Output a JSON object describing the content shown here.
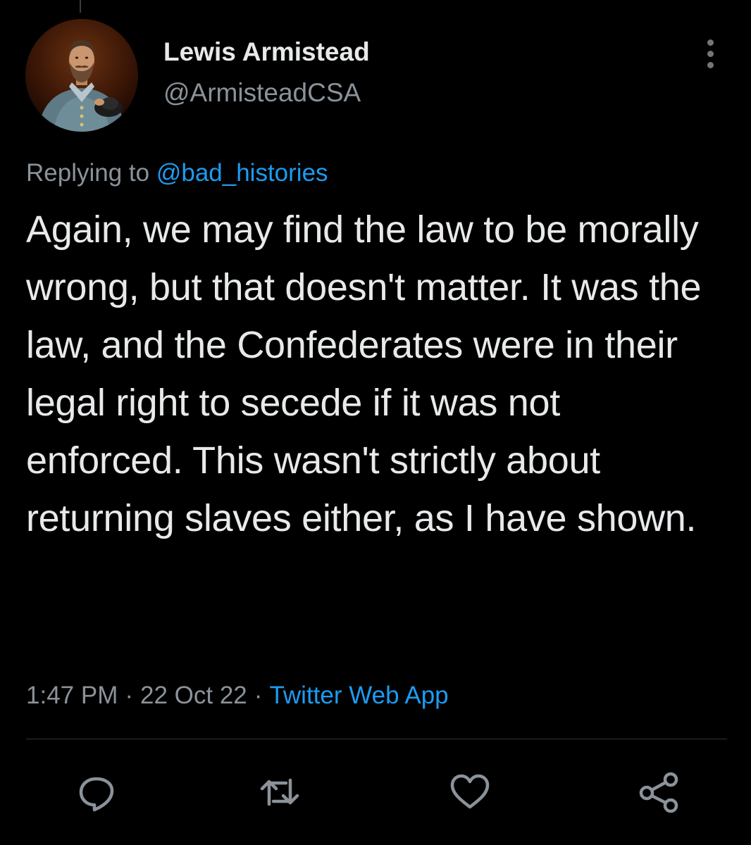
{
  "tweet": {
    "author": {
      "display_name": "Lewis Armistead",
      "handle": "@ArmisteadCSA",
      "avatar_icon": "portrait-avatar"
    },
    "reply_context": {
      "prefix": "Replying to ",
      "mention": "@bad_histories"
    },
    "text": "Again, we may find the law to be morally wrong, but that doesn't matter. It was the law, and the Confederates were in their legal right to secede if it was not enforced. This wasn't strictly about returning slaves either, as I have shown.",
    "meta": {
      "time": "1:47 PM",
      "separator": "·",
      "date": "22 Oct 22",
      "source": "Twitter Web App"
    }
  },
  "actions": [
    {
      "icon": "reply-icon"
    },
    {
      "icon": "retweet-icon"
    },
    {
      "icon": "like-icon"
    },
    {
      "icon": "share-icon"
    }
  ],
  "colors": {
    "background": "#000000",
    "text_primary": "#e7e9ea",
    "text_secondary": "#8b9299",
    "link": "#1d9bf0",
    "icon": "#8b9299",
    "divider": "#2f3336"
  }
}
